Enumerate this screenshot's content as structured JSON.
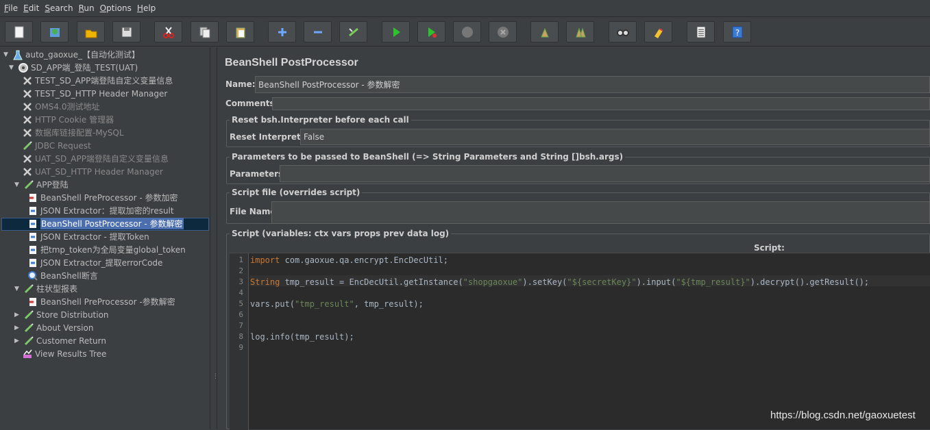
{
  "menu": [
    {
      "key": "F",
      "rest": "ile"
    },
    {
      "key": "E",
      "rest": "dit"
    },
    {
      "key": "S",
      "rest": "earch"
    },
    {
      "key": "R",
      "rest": "un"
    },
    {
      "key": "O",
      "rest": "ptions"
    },
    {
      "key": "H",
      "rest": "elp"
    }
  ],
  "toolbar_icons": [
    "new-icon",
    "templates-icon",
    "open-icon",
    "save-icon",
    "cut-icon",
    "copy-icon",
    "paste-icon",
    "expand-icon",
    "collapse-icon",
    "toggle-icon",
    "start-icon",
    "start-no-pauses-icon",
    "stop-icon",
    "shutdown-icon",
    "clear-icon",
    "clear-all-icon",
    "search-icon",
    "reset-search-icon",
    "function-helper-icon",
    "help-icon"
  ],
  "tree": {
    "items": [
      {
        "label": "auto_gaoxue_【自动化测试】",
        "icon": "test-plan-icon",
        "arrow": "▼",
        "disabled": false
      },
      {
        "label": "SD_APP端_登陆_TEST(UAT)",
        "icon": "thread-group-icon",
        "arrow": "▼",
        "disabled": false
      },
      {
        "label": "TEST_SD_APP端登陆自定义变量信息",
        "icon": "config-icon",
        "arrow": "",
        "disabled": false
      },
      {
        "label": "TEST_SD_HTTP Header Manager",
        "icon": "config-icon",
        "arrow": "",
        "disabled": false
      },
      {
        "label": "OMS4.0测试地址",
        "icon": "config-icon",
        "arrow": "",
        "disabled": true
      },
      {
        "label": "HTTP Cookie 管理器",
        "icon": "config-icon",
        "arrow": "",
        "disabled": true
      },
      {
        "label": "数据库链接配置-MySQL",
        "icon": "config-icon",
        "arrow": "",
        "disabled": true
      },
      {
        "label": "JDBC Request",
        "icon": "sampler-icon",
        "arrow": "",
        "disabled": true
      },
      {
        "label": "UAT_SD_APP端登陆自定义变量信息",
        "icon": "config-icon",
        "arrow": "",
        "disabled": true
      },
      {
        "label": "UAT_SD_HTTP Header Manager",
        "icon": "config-icon",
        "arrow": "",
        "disabled": true
      },
      {
        "label": "APP登陆",
        "icon": "sampler-icon",
        "arrow": "▼",
        "disabled": false
      },
      {
        "label": "BeanShell PreProcessor - 参数加密",
        "icon": "preprocessor-icon",
        "arrow": "",
        "disabled": false
      },
      {
        "label": "JSON Extractor：提取加密的result",
        "icon": "postprocessor-icon",
        "arrow": "",
        "disabled": false
      },
      {
        "label": "BeanShell PostProcessor - 参数解密",
        "icon": "postprocessor-icon",
        "arrow": "",
        "disabled": false,
        "selected": true
      },
      {
        "label": "JSON Extractor - 提取Token",
        "icon": "postprocessor-icon",
        "arrow": "",
        "disabled": false
      },
      {
        "label": "把tmp_token为全局变量global_token",
        "icon": "postprocessor-icon",
        "arrow": "",
        "disabled": false
      },
      {
        "label": "JSON Extractor_提取errorCode",
        "icon": "postprocessor-icon",
        "arrow": "",
        "disabled": false
      },
      {
        "label": "BeanShell断言",
        "icon": "assertion-icon",
        "arrow": "",
        "disabled": false
      },
      {
        "label": "柱状型报表",
        "icon": "sampler-icon",
        "arrow": "▼",
        "disabled": false
      },
      {
        "label": "BeanShell PreProcessor -参数解密",
        "icon": "preprocessor-icon",
        "arrow": "",
        "disabled": false
      },
      {
        "label": "Store Distribution",
        "icon": "sampler-icon",
        "arrow": "▶",
        "disabled": false
      },
      {
        "label": "About Version",
        "icon": "sampler-icon",
        "arrow": "▶",
        "disabled": false
      },
      {
        "label": "Customer Return",
        "icon": "sampler-icon",
        "arrow": "▶",
        "disabled": false
      },
      {
        "label": "View Results Tree",
        "icon": "listener-icon",
        "arrow": "",
        "disabled": false
      }
    ]
  },
  "panel": {
    "title": "BeanShell PostProcessor",
    "name_label": "Name:",
    "name_value": "BeanShell PostProcessor - 参数解密",
    "comments_label": "Comments:",
    "reset_group": "Reset bsh.Interpreter before each call",
    "reset_label": "Reset Interpreter:",
    "reset_value": "False",
    "params_group": "Parameters to be passed to BeanShell (=> String Parameters and String []bsh.args)",
    "params_label": "Parameters:",
    "file_group": "Script file (overrides script)",
    "file_label": "File Name:",
    "script_group": "Script (variables: ctx vars props prev data log)",
    "script_header": "Script:"
  },
  "script_lines": [
    "import com.gaoxue.qa.encrypt.EncDecUtil;",
    "",
    "String tmp_result = EncDecUtil.getInstance(\"shopgaoxue\").setKey(\"${secretKey}\").input(\"${tmp_result}\").decrypt().getResult();",
    "",
    "vars.put(\"tmp_result\", tmp_result);",
    "",
    "",
    "log.info(tmp_result);",
    ""
  ],
  "watermark": "https://blog.csdn.net/gaoxuetest"
}
